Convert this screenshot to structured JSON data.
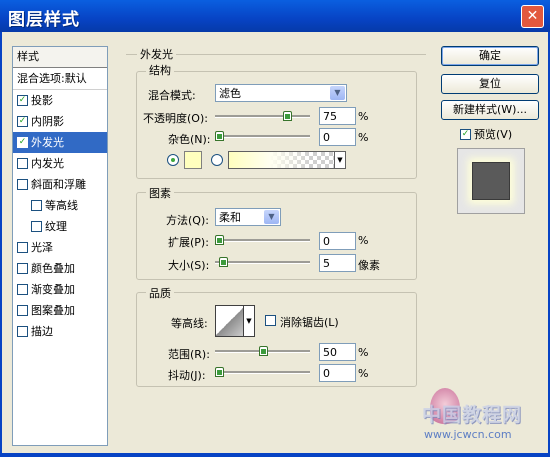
{
  "window": {
    "title": "图层样式"
  },
  "sidebar": {
    "header": "样式",
    "blend": "混合选项:默认",
    "items": [
      {
        "label": "投影",
        "checked": true,
        "sub": false,
        "selected": false
      },
      {
        "label": "内阴影",
        "checked": true,
        "sub": false,
        "selected": false
      },
      {
        "label": "外发光",
        "checked": true,
        "sub": false,
        "selected": true
      },
      {
        "label": "内发光",
        "checked": false,
        "sub": false,
        "selected": false
      },
      {
        "label": "斜面和浮雕",
        "checked": false,
        "sub": false,
        "selected": false
      },
      {
        "label": "等高线",
        "checked": false,
        "sub": true,
        "selected": false
      },
      {
        "label": "纹理",
        "checked": false,
        "sub": true,
        "selected": false
      },
      {
        "label": "光泽",
        "checked": false,
        "sub": false,
        "selected": false
      },
      {
        "label": "颜色叠加",
        "checked": false,
        "sub": false,
        "selected": false
      },
      {
        "label": "渐变叠加",
        "checked": false,
        "sub": false,
        "selected": false
      },
      {
        "label": "图案叠加",
        "checked": false,
        "sub": false,
        "selected": false
      },
      {
        "label": "描边",
        "checked": false,
        "sub": false,
        "selected": false
      }
    ]
  },
  "panel": {
    "title": "外发光",
    "structure": {
      "title": "结构",
      "blend_mode_label": "混合模式:",
      "blend_mode": "滤色",
      "opacity_label": "不透明度(O):",
      "opacity": "75",
      "opacity_unit": "%",
      "noise_label": "杂色(N):",
      "noise": "0",
      "noise_unit": "%",
      "swatch_color": "#ffffbe"
    },
    "elements": {
      "title": "图素",
      "technique_label": "方法(Q):",
      "technique": "柔和",
      "spread_label": "扩展(P):",
      "spread": "0",
      "spread_unit": "%",
      "size_label": "大小(S):",
      "size": "5",
      "size_unit": "像素"
    },
    "quality": {
      "title": "品质",
      "contour_label": "等高线:",
      "antialias_label": "消除锯齿(L)",
      "range_label": "范围(R):",
      "range": "50",
      "range_unit": "%",
      "jitter_label": "抖动(J):",
      "jitter": "0",
      "jitter_unit": "%"
    }
  },
  "buttons": {
    "ok": "确定",
    "reset": "复位",
    "new_style": "新建样式(W)...",
    "preview": "预览(V)"
  },
  "watermark": {
    "line1": "中国教程网",
    "line2": "www.jcwcn.com"
  }
}
